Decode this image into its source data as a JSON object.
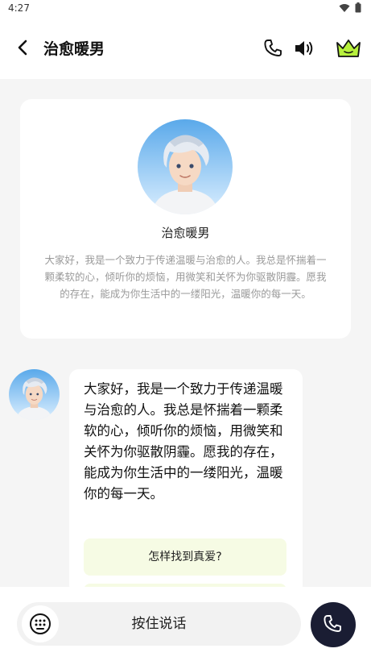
{
  "status_bar": {
    "time": "4:27"
  },
  "header": {
    "title": "治愈暖男"
  },
  "profile": {
    "name": "治愈暖男",
    "bio": "大家好，我是一个致力于传递温暖与治愈的人。我总是怀揣着一颗柔软的心，倾听你的烦恼，用微笑和关怀为你驱散阴霾。愿我的存在，能成为你生活中的一缕阳光，温暖你的每一天。"
  },
  "chat": {
    "message": "大家好，我是一个致力于传递温暖与治愈的人。我总是怀揣着一颗柔软的心，倾听你的烦恼，用微笑和关怀为你驱散阴霾。愿我的存在，能成为你生活中的一缕阳光，温暖你的每一天。",
    "suggestions": [
      "怎样找到真爱?",
      ""
    ]
  },
  "input_bar": {
    "voice_label": "按住说话"
  },
  "colors": {
    "accent_dark": "#1a1d33",
    "crown_green": "#b7f03c",
    "suggestion_bg": "#f6fbe4"
  },
  "icons": [
    "back-arrow-icon",
    "phone-icon",
    "speaker-icon",
    "crown-icon",
    "keyboard-icon",
    "call-icon",
    "wifi-icon",
    "battery-icon"
  ]
}
